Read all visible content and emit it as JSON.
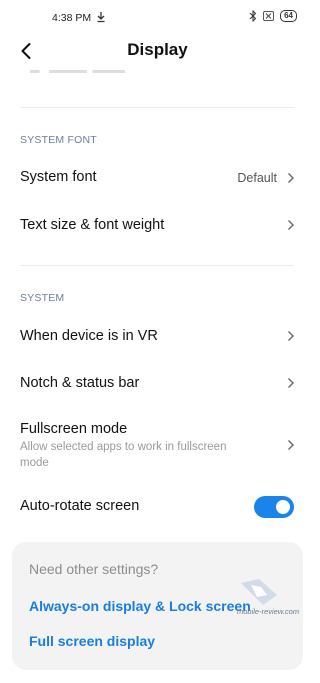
{
  "status_bar": {
    "time": "4:38 PM",
    "battery": "64"
  },
  "header": {
    "title": "Display"
  },
  "sections": {
    "system_font": {
      "title": "SYSTEM FONT",
      "items": [
        {
          "label": "System font",
          "value": "Default"
        },
        {
          "label": "Text size & font weight"
        }
      ]
    },
    "system": {
      "title": "SYSTEM",
      "items": [
        {
          "label": "When device is in VR"
        },
        {
          "label": "Notch & status bar"
        },
        {
          "label": "Fullscreen mode",
          "subtitle": "Allow selected apps to work in fullscreen mode"
        },
        {
          "label": "Auto-rotate screen",
          "toggle": true
        }
      ]
    }
  },
  "card": {
    "title": "Need other settings?",
    "links": [
      "Always-on display & Lock screen",
      "Full screen display"
    ]
  },
  "watermark": {
    "text": "mobile-review.com"
  },
  "colors": {
    "accent": "#1a84e8",
    "link": "#1a7de2",
    "section_title": "#6b7fa0",
    "card_bg": "#f3f3f3"
  }
}
